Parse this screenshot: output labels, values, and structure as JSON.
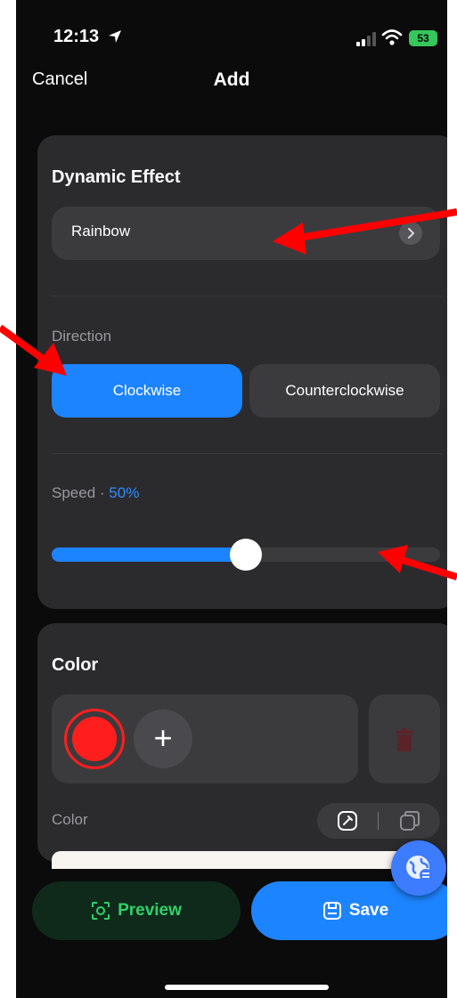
{
  "status_bar": {
    "time": "12:13",
    "battery": "53"
  },
  "nav": {
    "cancel_label": "Cancel",
    "title": "Add"
  },
  "dynamic_effect": {
    "title": "Dynamic Effect",
    "selected": "Rainbow",
    "direction_label": "Direction",
    "direction_options": [
      "Clockwise",
      "Counterclockwise"
    ],
    "direction_selected": "Clockwise",
    "speed_label": "Speed ·",
    "speed_value_text": "50%",
    "speed_fraction": 0.5
  },
  "color_section": {
    "title": "Color",
    "colors": [
      "#ff1e1e"
    ],
    "add_label": "+",
    "color_label": "Color"
  },
  "actions": {
    "preview_label": "Preview",
    "save_label": "Save"
  },
  "colors": {
    "accent": "#1d84ff",
    "preview_text": "#2fd16a",
    "annotation_arrow": "#ff0000"
  }
}
